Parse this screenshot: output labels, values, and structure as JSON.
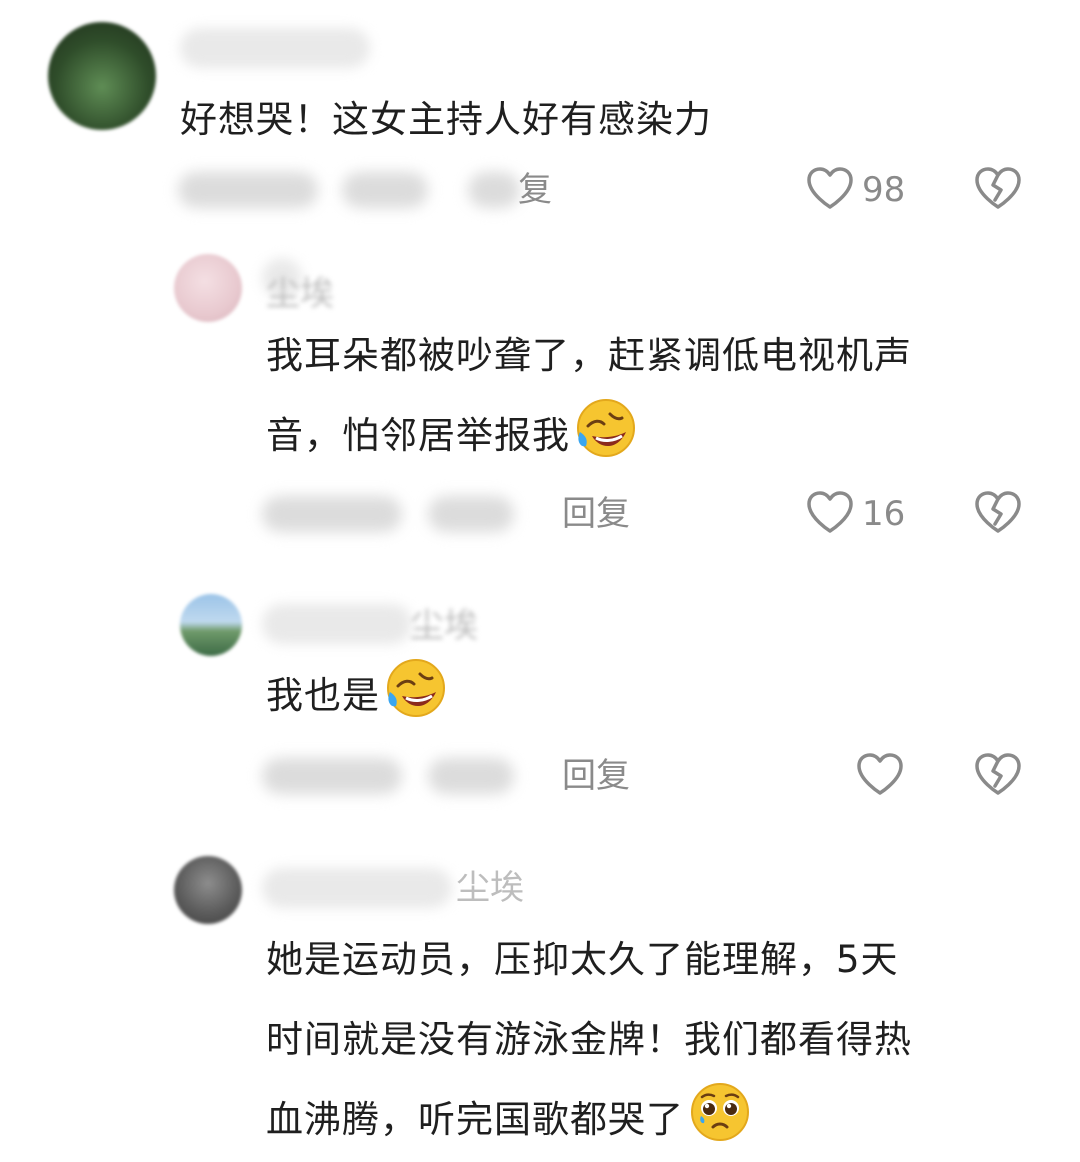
{
  "comments": [
    {
      "text_lines": [
        "好想哭！这女主持人好有感染力"
      ],
      "reply_label": "复",
      "like_count": "98"
    },
    {
      "name_tail": "尘埃",
      "text_lines": [
        "我耳朵都被吵聋了，赶紧调低电视机声",
        "音，怕邻居举报我"
      ],
      "reply_label": "回复",
      "like_count": "16"
    },
    {
      "name_tail": "尘埃",
      "text_lines": [
        "我也是"
      ],
      "reply_label": "回复",
      "like_count": ""
    },
    {
      "name_tail": "尘埃",
      "text_lines": [
        "她是运动员，压抑太久了能理解，5天",
        "时间就是没有游泳金牌！我们都看得热",
        "血沸腾，听完国歌都哭了"
      ],
      "reply_label": "",
      "like_count": ""
    }
  ],
  "icons": {
    "like": "heart-outline-icon",
    "dislike": "broken-heart-icon",
    "emoji_laugh_cry": "rolling-on-floor-laughing-emoji",
    "emoji_pleading": "pleading-face-emoji"
  },
  "colors": {
    "text": "#1f1f1f",
    "meta": "#8a8a8a",
    "background": "#ffffff"
  }
}
